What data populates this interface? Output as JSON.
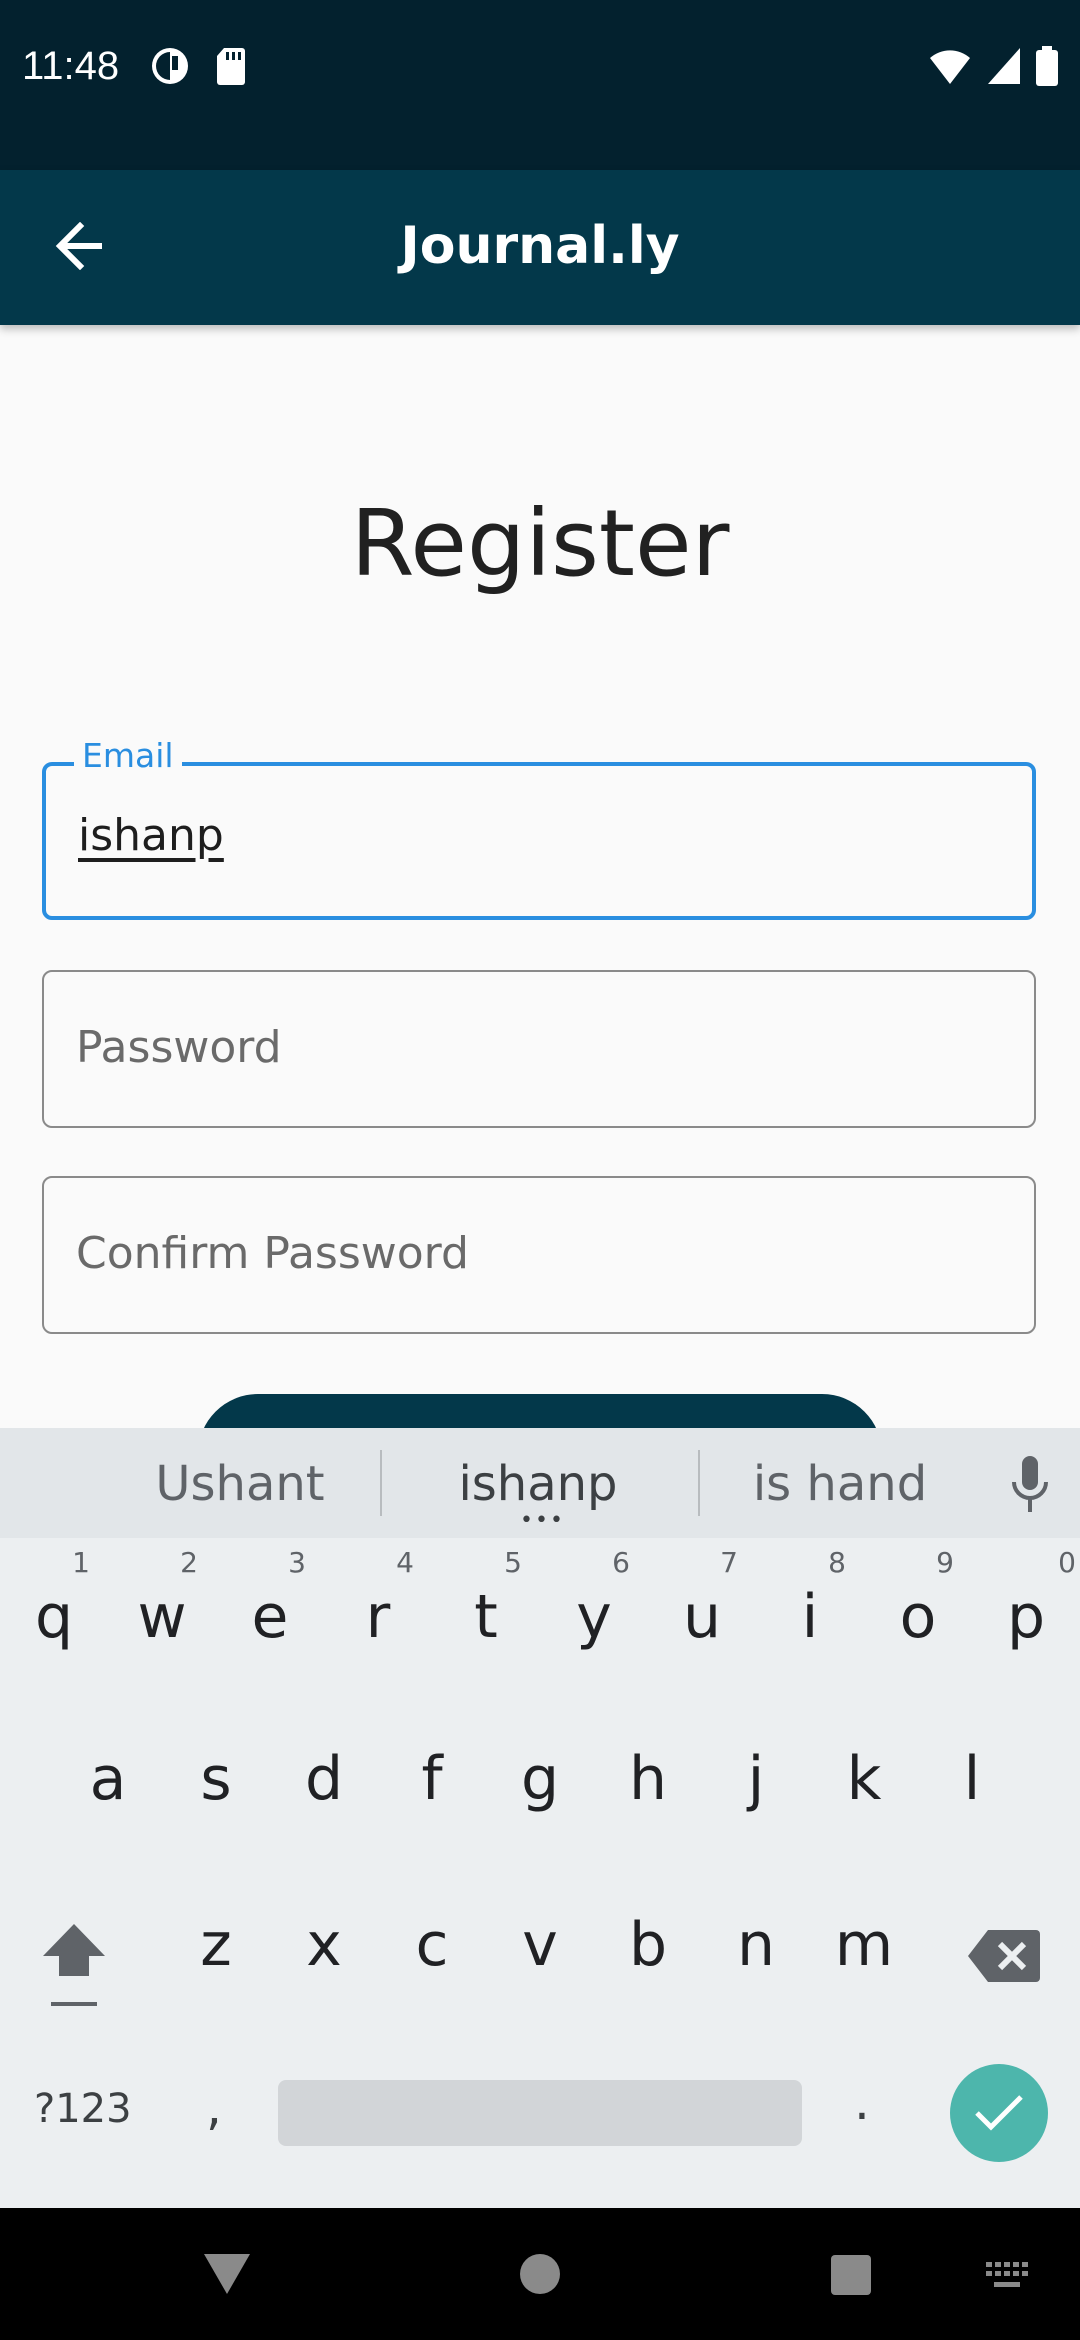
{
  "status_bar": {
    "time": "11:48"
  },
  "app_bar": {
    "title": "Journal.ly"
  },
  "page": {
    "title": "Register"
  },
  "form": {
    "email": {
      "label": "Email",
      "value": "ishanp"
    },
    "password": {
      "placeholder": "Password"
    },
    "confirm_password": {
      "placeholder": "Confirm Password"
    }
  },
  "keyboard": {
    "suggestions": [
      "Ushant",
      "ishanp",
      "is hand"
    ],
    "row1": [
      {
        "key": "q",
        "hint": "1"
      },
      {
        "key": "w",
        "hint": "2"
      },
      {
        "key": "e",
        "hint": "3"
      },
      {
        "key": "r",
        "hint": "4"
      },
      {
        "key": "t",
        "hint": "5"
      },
      {
        "key": "y",
        "hint": "6"
      },
      {
        "key": "u",
        "hint": "7"
      },
      {
        "key": "i",
        "hint": "8"
      },
      {
        "key": "o",
        "hint": "9"
      },
      {
        "key": "p",
        "hint": "0"
      }
    ],
    "row2": [
      "a",
      "s",
      "d",
      "f",
      "g",
      "h",
      "j",
      "k",
      "l"
    ],
    "row3": [
      "z",
      "x",
      "c",
      "v",
      "b",
      "n",
      "m"
    ],
    "symbols_label": "?123",
    "comma": ",",
    "period": "."
  },
  "colors": {
    "status_bar": "#03212e",
    "app_bar": "#03384a",
    "focus_accent": "#2a8ee0",
    "enter_key": "#4db6ac"
  },
  "icons": {
    "back": "arrow-left-icon",
    "mic": "microphone-icon",
    "shift": "shift-icon",
    "backspace": "backspace-icon",
    "enter": "check-icon"
  }
}
